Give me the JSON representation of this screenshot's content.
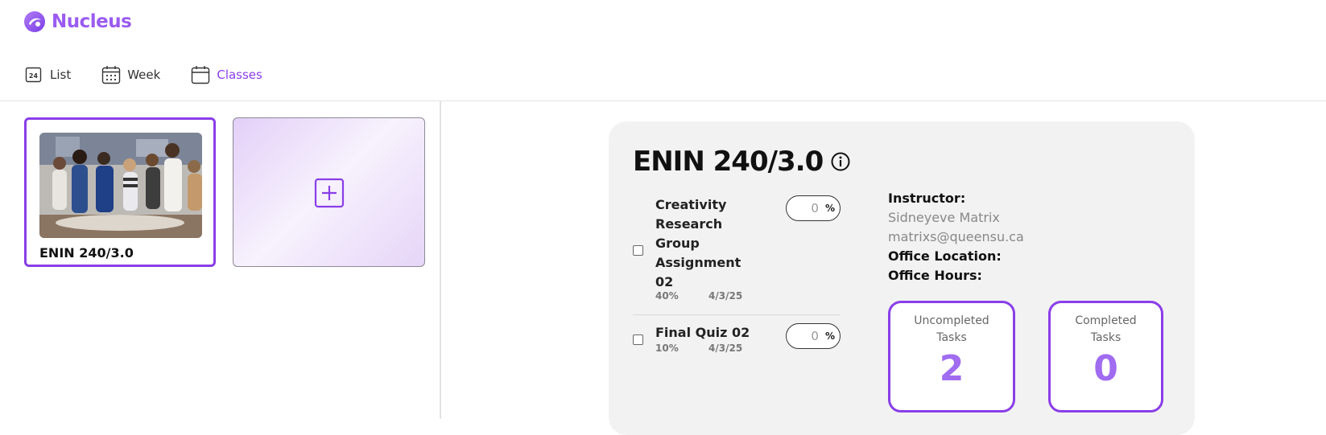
{
  "app": {
    "name": "Nucleus"
  },
  "nav": {
    "list_label": "List",
    "list_icon": "calendar-24-icon",
    "week_label": "Week",
    "week_icon": "calendar-grid-icon",
    "classes_label": "Classes",
    "classes_icon": "calendar-icon",
    "active": "Classes"
  },
  "courses": [
    {
      "name": "ENIN 240/3.0",
      "selected": true
    }
  ],
  "add_course": {
    "icon": "plus-square-icon"
  },
  "course_detail": {
    "title": "ENIN 240/3.0",
    "info_icon": "info-icon",
    "tasks": [
      {
        "name": "Creativity Research Group Assignment 02",
        "weight": "40%",
        "date": "4/3/25",
        "grade": "0",
        "unit": "%",
        "completed": false
      },
      {
        "name": "Final Quiz 02",
        "weight": "10%",
        "date": "4/3/25",
        "grade": "0",
        "unit": "%",
        "completed": false
      }
    ],
    "instructor_label": "Instructor:",
    "instructor_name": "Sidneyeve Matrix",
    "instructor_email": "matrixs@queensu.ca",
    "office_location_label": "Office Location:",
    "office_hours_label": "Office Hours:",
    "stats": {
      "uncompleted_label": "Uncompleted Tasks",
      "uncompleted_value": "2",
      "completed_label": "Completed Tasks",
      "completed_value": "0"
    }
  },
  "colors": {
    "accent": "#8a3ee8",
    "accent_light": "#a06cf0",
    "card_bg": "#f2f2f2"
  }
}
